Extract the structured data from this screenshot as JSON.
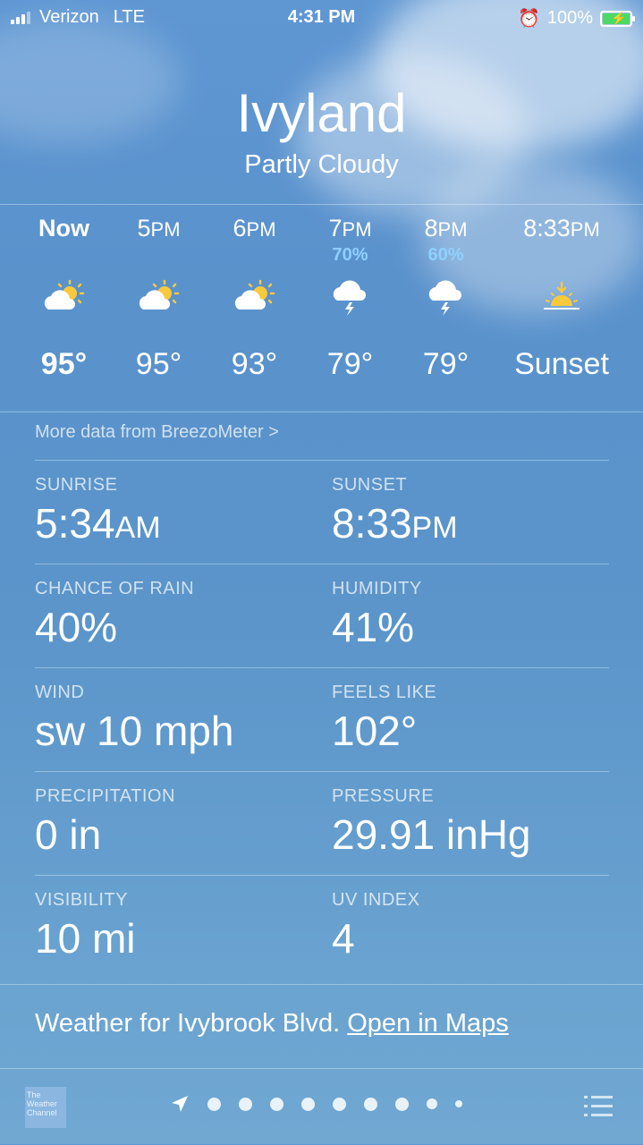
{
  "status": {
    "carrier": "Verizon",
    "network": "LTE",
    "time": "4:31 PM",
    "battery": "100%"
  },
  "location": {
    "city": "Ivyland",
    "condition": "Partly Cloudy"
  },
  "hourly": [
    {
      "time": "Now",
      "bold": true,
      "precip": "",
      "icon": "partly-cloudy-icon",
      "temp": "95°"
    },
    {
      "time": "5",
      "suffix": "PM",
      "precip": "",
      "icon": "partly-cloudy-icon",
      "temp": "95°"
    },
    {
      "time": "6",
      "suffix": "PM",
      "precip": "",
      "icon": "partly-cloudy-icon",
      "temp": "93°"
    },
    {
      "time": "7",
      "suffix": "PM",
      "precip": "70%",
      "icon": "thunderstorm-icon",
      "temp": "79°"
    },
    {
      "time": "8",
      "suffix": "PM",
      "precip": "60%",
      "icon": "thunderstorm-icon",
      "temp": "79°"
    },
    {
      "time": "8:33",
      "suffix": "PM",
      "precip": "",
      "icon": "sunset-icon",
      "temp": "Sunset"
    }
  ],
  "breezometer_link": "More data from BreezoMeter >",
  "details": [
    {
      "left": {
        "label": "SUNRISE",
        "value": "5:34",
        "unit": "AM"
      },
      "right": {
        "label": "SUNSET",
        "value": "8:33",
        "unit": "PM"
      }
    },
    {
      "left": {
        "label": "CHANCE OF RAIN",
        "value": "40%"
      },
      "right": {
        "label": "HUMIDITY",
        "value": "41%"
      }
    },
    {
      "left": {
        "label": "WIND",
        "value": "sw 10 mph"
      },
      "right": {
        "label": "FEELS LIKE",
        "value": "102°"
      }
    },
    {
      "left": {
        "label": "PRECIPITATION",
        "value": "0 in"
      },
      "right": {
        "label": "PRESSURE",
        "value": "29.91 inHg"
      }
    },
    {
      "left": {
        "label": "VISIBILITY",
        "value": "10 mi"
      },
      "right": {
        "label": "UV INDEX",
        "value": "4"
      }
    }
  ],
  "footer": {
    "weather_for": "Weather for Ivybrook Blvd.",
    "open_maps": "Open in Maps",
    "logo_text": "The Weather Channel"
  },
  "colors": {
    "precip": "#8fd0ff",
    "sun": "#f9c93c",
    "battery": "#4cd964"
  }
}
